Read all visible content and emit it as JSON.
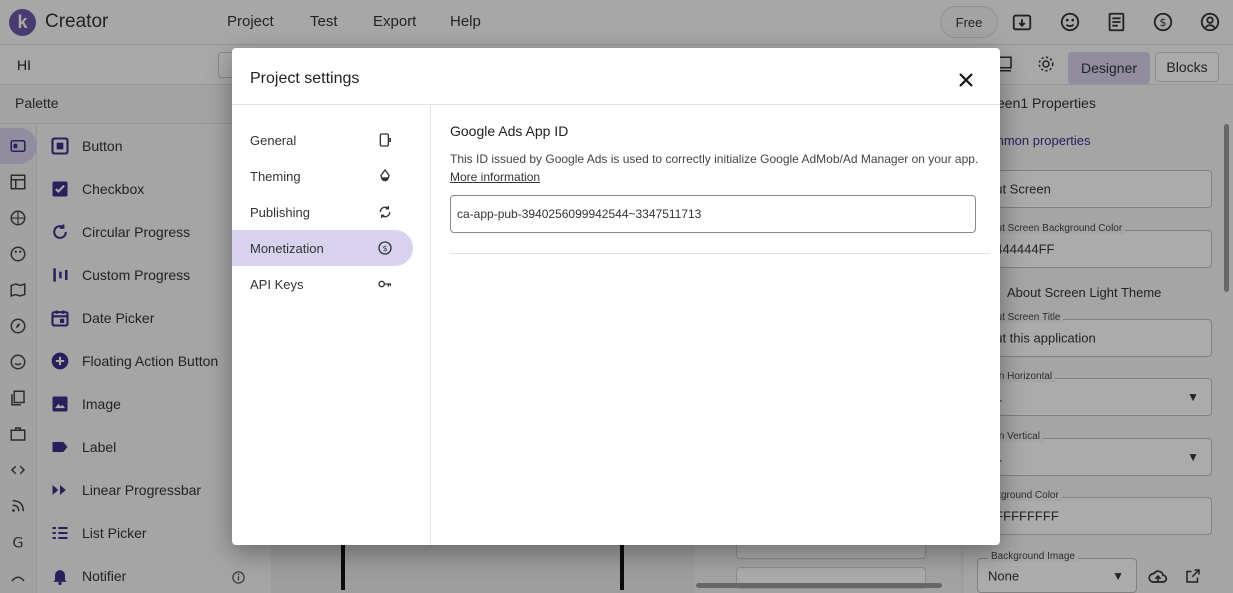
{
  "app": {
    "logo_letter": "k",
    "brand": "Creator",
    "menu": [
      "Project",
      "Test",
      "Export",
      "Help"
    ],
    "plan_label": "Free",
    "project_name": "HI",
    "accent_color": "#6a58a8",
    "selected_color": "#d9d2ee"
  },
  "toolbar": {
    "designer_label": "Designer",
    "blocks_label": "Blocks"
  },
  "palette": {
    "title": "Palette",
    "items": [
      {
        "label": "Button",
        "icon": "button-icon"
      },
      {
        "label": "Checkbox",
        "icon": "checkbox-icon"
      },
      {
        "label": "Circular Progress",
        "icon": "circular-progress-icon"
      },
      {
        "label": "Custom Progress",
        "icon": "custom-progress-icon"
      },
      {
        "label": "Date Picker",
        "icon": "date-picker-icon"
      },
      {
        "label": "Floating Action Button",
        "icon": "fab-icon"
      },
      {
        "label": "Image",
        "icon": "image-icon"
      },
      {
        "label": "Label",
        "icon": "label-icon"
      },
      {
        "label": "Linear Progressbar",
        "icon": "linear-progressbar-icon"
      },
      {
        "label": "List Picker",
        "icon": "list-picker-icon"
      },
      {
        "label": "Notifier",
        "icon": "notifier-icon"
      }
    ]
  },
  "properties": {
    "title": "een1 Properties",
    "section": "mmon properties",
    "fields": {
      "about_screen": "out Screen",
      "bg_color_legend": "out Screen Background Color",
      "bg_color_value": "#444444FF",
      "light_theme_label": "About Screen Light Theme",
      "title_legend": "out Screen Title",
      "title_value": "out this application",
      "align_h_legend": "ign Horizontal",
      "align_h_value": ": 1",
      "align_v_legend": "ign Vertical",
      "align_v_value": ": 1",
      "background_color_legend": "ckground Color",
      "background_color_value": "#FFFFFFFF",
      "background_image_legend": "Background Image",
      "background_image_value": "None"
    }
  },
  "dialog": {
    "title": "Project settings",
    "sections": [
      {
        "label": "General",
        "icon": "general-icon",
        "active": false
      },
      {
        "label": "Theming",
        "icon": "theming-icon",
        "active": false
      },
      {
        "label": "Publishing",
        "icon": "publishing-icon",
        "active": false
      },
      {
        "label": "Monetization",
        "icon": "monetization-icon",
        "active": true
      },
      {
        "label": "API Keys",
        "icon": "api-keys-icon",
        "active": false
      }
    ],
    "content": {
      "title": "Google Ads App ID",
      "description": "This ID issued by Google Ads is used to correctly initialize Google AdMob/Ad Manager on your app.",
      "more_link": "More information",
      "app_id_value": "ca-app-pub-3940256099942544~3347511713"
    }
  }
}
